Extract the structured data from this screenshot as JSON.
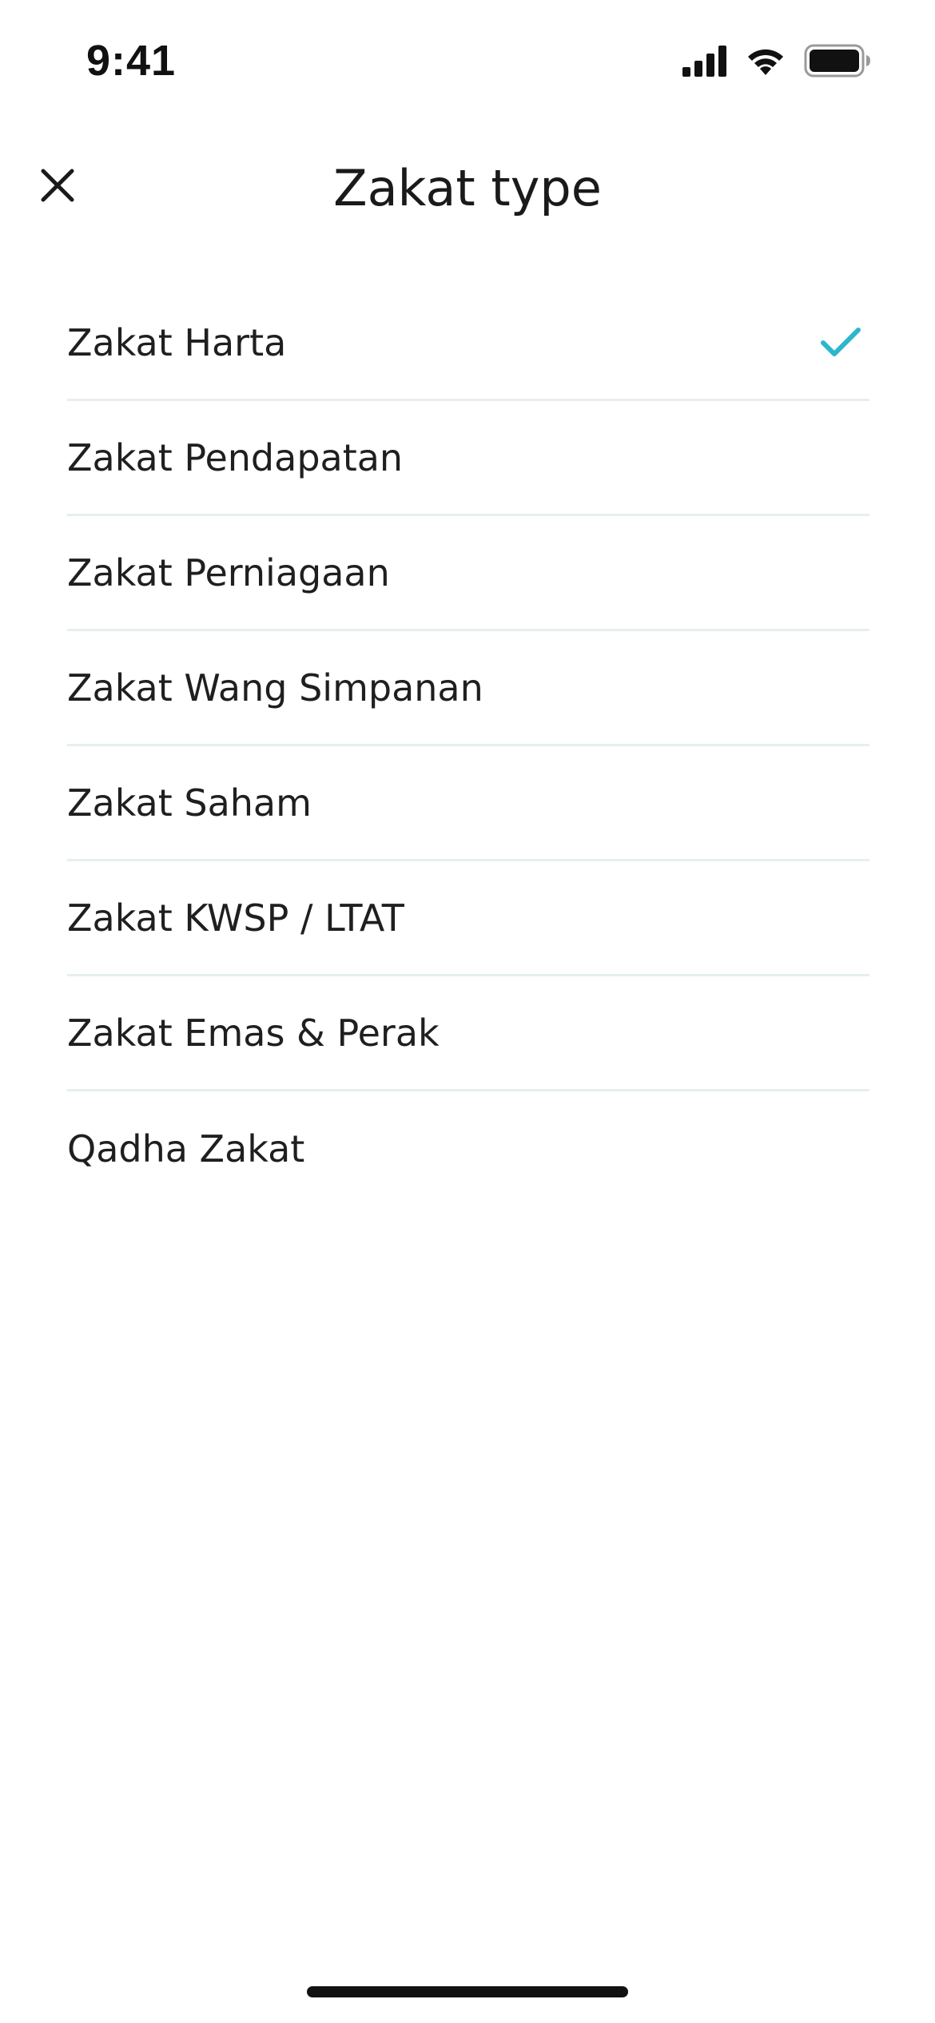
{
  "status_bar": {
    "time": "9:41",
    "icons": [
      "cellular-signal-icon",
      "wifi-icon",
      "battery-icon"
    ]
  },
  "header": {
    "title": "Zakat type",
    "close_icon": "close-icon"
  },
  "options": [
    {
      "label": "Zakat Harta",
      "selected": true
    },
    {
      "label": "Zakat Pendapatan",
      "selected": false
    },
    {
      "label": "Zakat Perniagaan",
      "selected": false
    },
    {
      "label": "Zakat Wang Simpanan",
      "selected": false
    },
    {
      "label": "Zakat Saham",
      "selected": false
    },
    {
      "label": "Zakat KWSP / LTAT",
      "selected": false
    },
    {
      "label": "Zakat Emas & Perak",
      "selected": false
    },
    {
      "label": "Qadha Zakat",
      "selected": false
    }
  ],
  "colors": {
    "accent": "#2bb7cc",
    "divider": "#e6eef0",
    "text": "#1f1f1f"
  }
}
